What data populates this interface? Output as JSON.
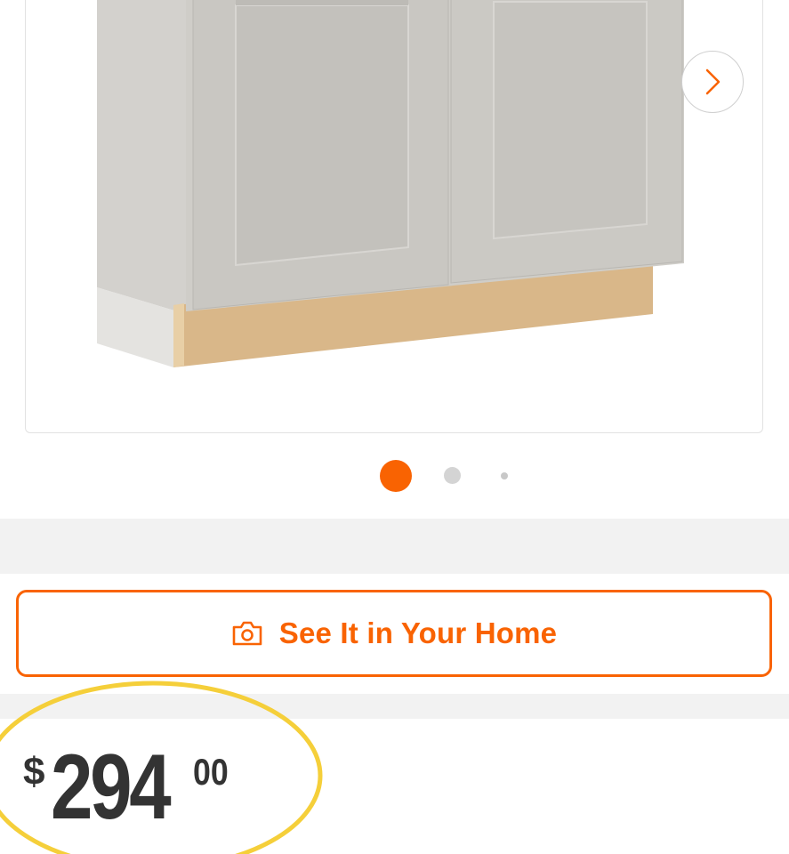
{
  "gallery": {
    "image_alt": "Base cabinet with two shaker doors",
    "next_icon": "chevron-right-icon",
    "active_slide": 1,
    "total_slides": 3
  },
  "ar_button": {
    "label": "See It in Your Home",
    "icon": "camera-icon"
  },
  "price": {
    "currency": "$",
    "dollars": "294",
    "cents": "00"
  },
  "colors": {
    "brand_orange": "#f96302",
    "price_text": "#333333",
    "highlight": "#f5cf3a"
  }
}
